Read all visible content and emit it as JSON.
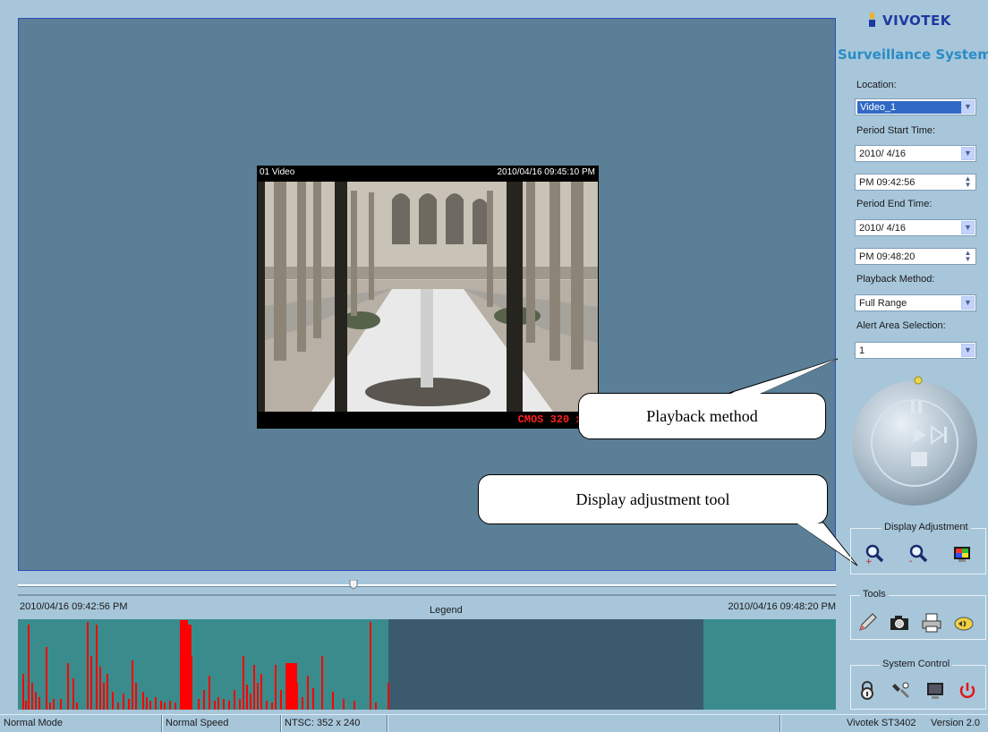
{
  "viewer": {
    "channel": "01  Video",
    "timestamp": "2010/04/16 09:45:10 PM",
    "resolution_overlay": "CMOS 320 x 2"
  },
  "callouts": {
    "playback_method": "Playback method",
    "display_adjustment": "Display adjustment tool"
  },
  "timeline": {
    "start_time": "2010/04/16 09:42:56 PM",
    "end_time": "2010/04/16 09:48:20 PM",
    "legend_label": "Legend",
    "colors": {
      "teal": "#3a8c8c",
      "dark": "#3b5a6e",
      "bar": "#ff0000"
    }
  },
  "brand": {
    "logo": "VIVOTEK",
    "title": "Surveillance System"
  },
  "panel": {
    "location_label": "Location:",
    "location_value": "Video_1",
    "period_start_label": "Period Start Time:",
    "start_date": "2010/  4/16",
    "start_time": "PM 09:42:56",
    "period_end_label": "Period End Time:",
    "end_date": "2010/  4/16",
    "end_time": "PM 09:48:20",
    "playback_method_label": "Playback Method:",
    "playback_method_value": "Full Range",
    "alert_area_label": "Alert Area Selection:",
    "alert_area_value": "1"
  },
  "groups": {
    "display_adjustment": "Display Adjustment",
    "tools": "Tools",
    "system_control": "System Control"
  },
  "icons": {
    "display": [
      "zoom-in-icon",
      "zoom-out-icon",
      "color-adjust-icon"
    ],
    "tools": [
      "pencil-icon",
      "snapshot-camera-icon",
      "print-icon",
      "audio-icon"
    ],
    "system": [
      "lock-icon",
      "settings-icon",
      "monitor-icon",
      "power-icon"
    ]
  },
  "statusbar": {
    "mode": "Normal Mode",
    "speed": "Normal Speed",
    "format": "NTSC: 352 x 240",
    "product": "Vivotek ST3402",
    "version": "Version 2.0"
  }
}
